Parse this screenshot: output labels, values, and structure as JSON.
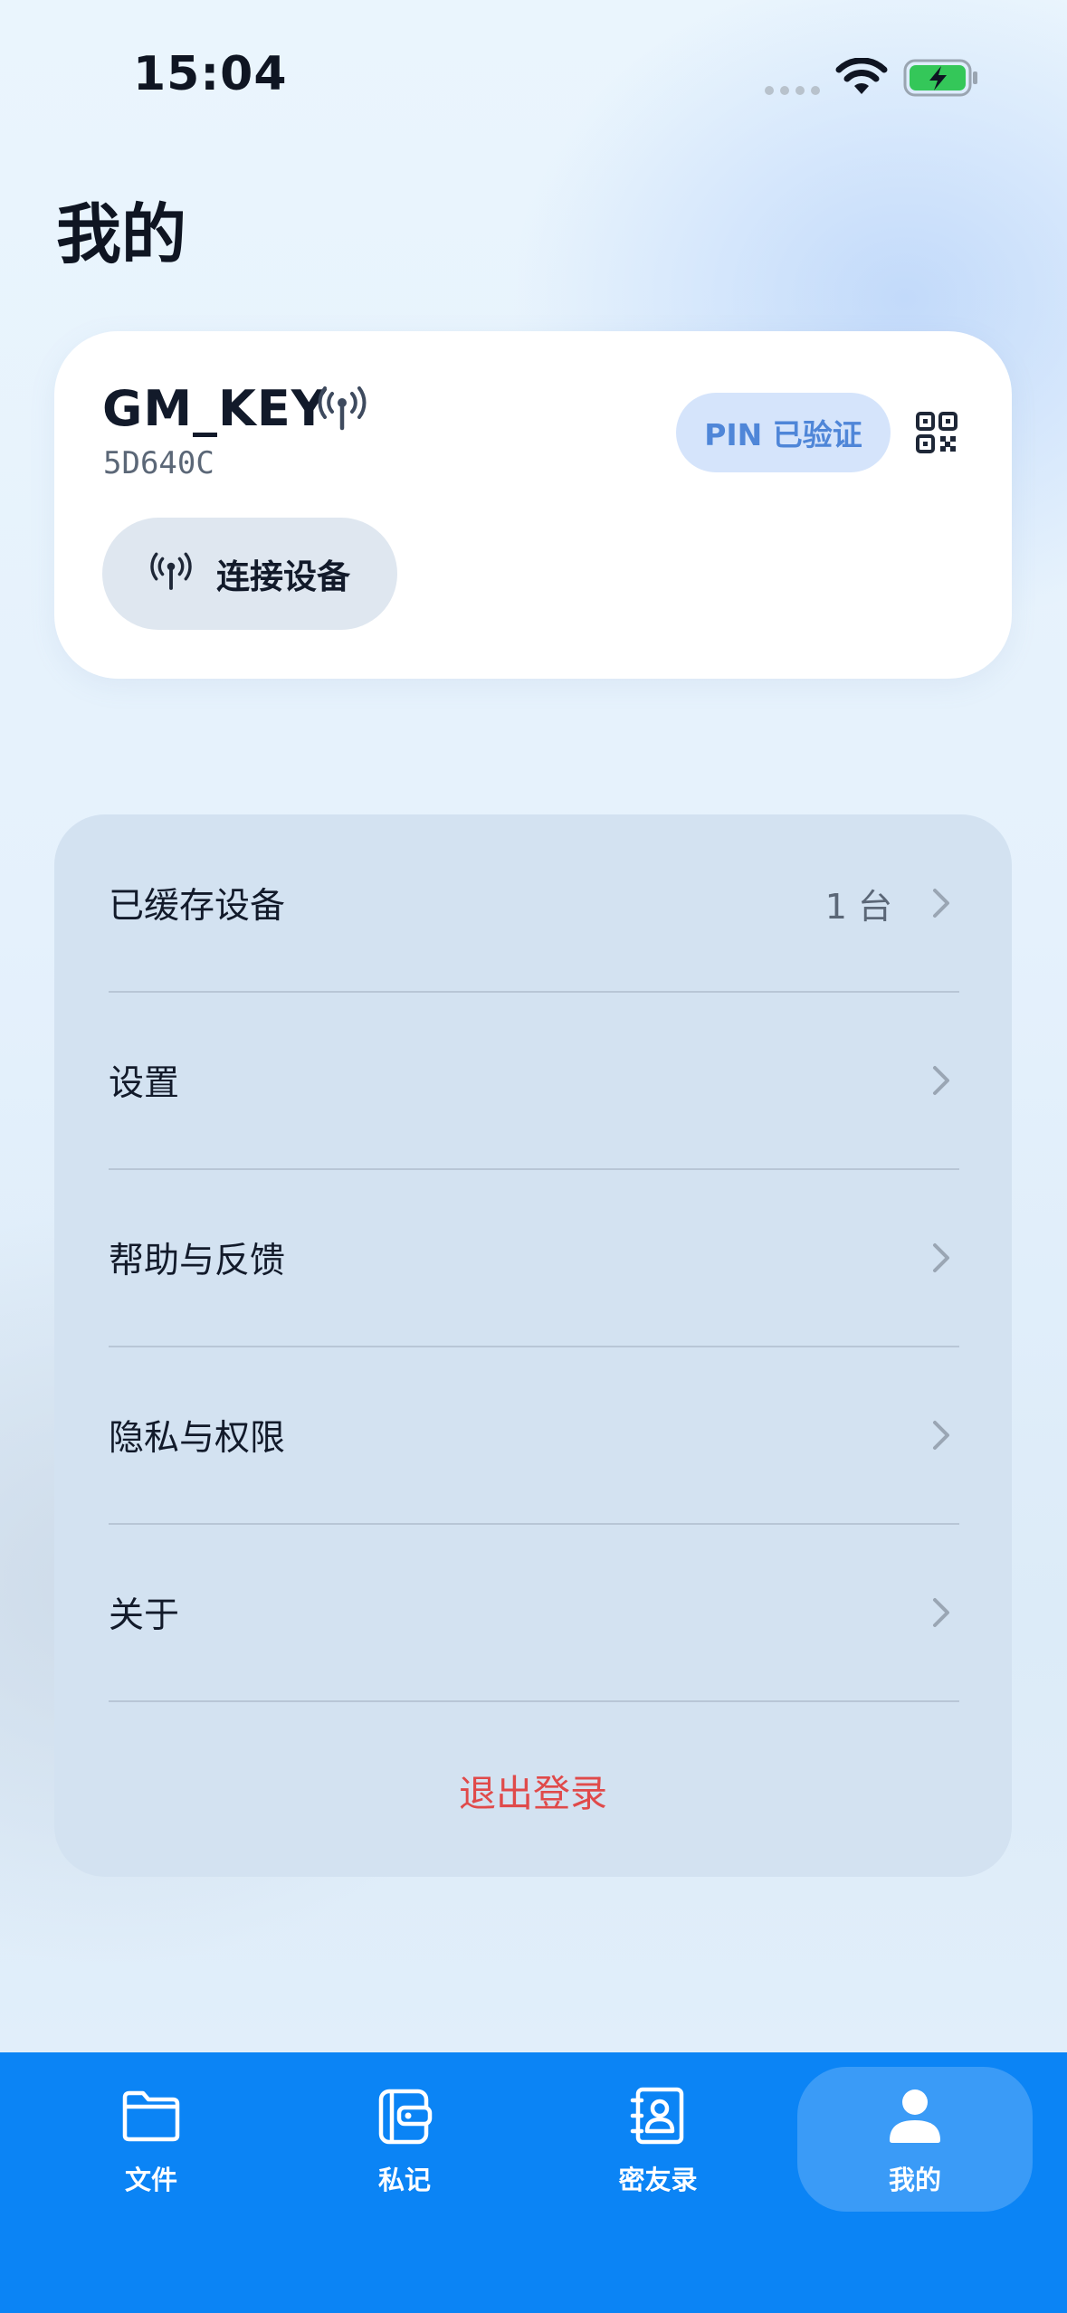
{
  "status_bar": {
    "time": "15:04"
  },
  "page": {
    "title": "我的"
  },
  "device": {
    "name": "GM_KEY",
    "serial": "5D640C",
    "pin_status": "PIN 已验证",
    "connect_label": "连接设备"
  },
  "menu": {
    "items": [
      {
        "label": "已缓存设备",
        "value": "1 台"
      },
      {
        "label": "设置",
        "value": ""
      },
      {
        "label": "帮助与反馈",
        "value": ""
      },
      {
        "label": "隐私与权限",
        "value": ""
      },
      {
        "label": "关于",
        "value": ""
      }
    ],
    "logout_label": "退出登录"
  },
  "tabbar": {
    "tabs": [
      {
        "label": "文件",
        "icon": "folder-icon"
      },
      {
        "label": "私记",
        "icon": "wallet-note-icon"
      },
      {
        "label": "密友录",
        "icon": "contacts-book-icon"
      },
      {
        "label": "我的",
        "icon": "person-icon"
      }
    ],
    "active_index": 3
  },
  "colors": {
    "accent": "#0b84f5",
    "pin_badge_text": "#4f86d8",
    "logout_text": "#e04a4a",
    "battery_fill": "#34c759"
  }
}
